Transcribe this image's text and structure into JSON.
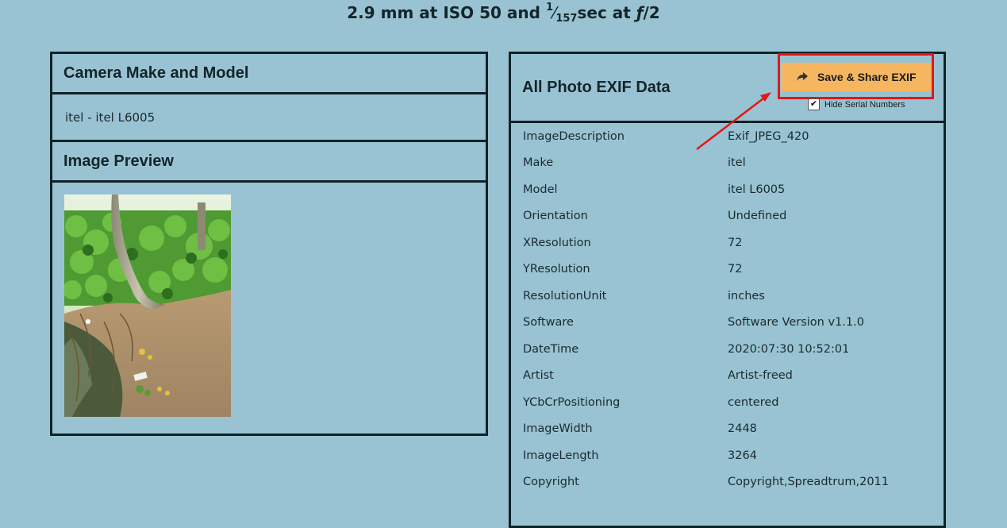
{
  "headline": {
    "focal": "2.9 mm at ISO 50 and ",
    "shutter_num": "1",
    "slash": "⁄",
    "shutter_den": "157",
    "sec": "sec at ",
    "f_symbol": "ƒ",
    "aperture": "/2"
  },
  "left": {
    "camera_title": "Camera Make and Model",
    "camera_value": "itel - itel L6005",
    "preview_title": "Image Preview"
  },
  "right": {
    "title": "All Photo EXIF Data",
    "save_button": "Save & Share EXIF",
    "hide_serial_label": "Hide Serial Numbers",
    "hide_serial_checked": true,
    "rows": [
      {
        "key": "ImageDescription",
        "value": "Exif_JPEG_420"
      },
      {
        "key": "Make",
        "value": "itel"
      },
      {
        "key": "Model",
        "value": "itel L6005"
      },
      {
        "key": "Orientation",
        "value": "Undefined"
      },
      {
        "key": "XResolution",
        "value": "72"
      },
      {
        "key": "YResolution",
        "value": "72"
      },
      {
        "key": "ResolutionUnit",
        "value": "inches"
      },
      {
        "key": "Software",
        "value": "Software Version v1.1.0"
      },
      {
        "key": "DateTime",
        "value": "2020:07:30 10:52:01"
      },
      {
        "key": "Artist",
        "value": "Artist-freed"
      },
      {
        "key": "YCbCrPositioning",
        "value": "centered"
      },
      {
        "key": "ImageWidth",
        "value": "2448"
      },
      {
        "key": "ImageLength",
        "value": "3264"
      },
      {
        "key": "Copyright",
        "value": "Copyright,Spreadtrum,2011"
      }
    ]
  },
  "colors": {
    "background": "#99c3d3",
    "border": "#0f2227",
    "button": "#f5b65f",
    "highlight": "#e01818"
  }
}
